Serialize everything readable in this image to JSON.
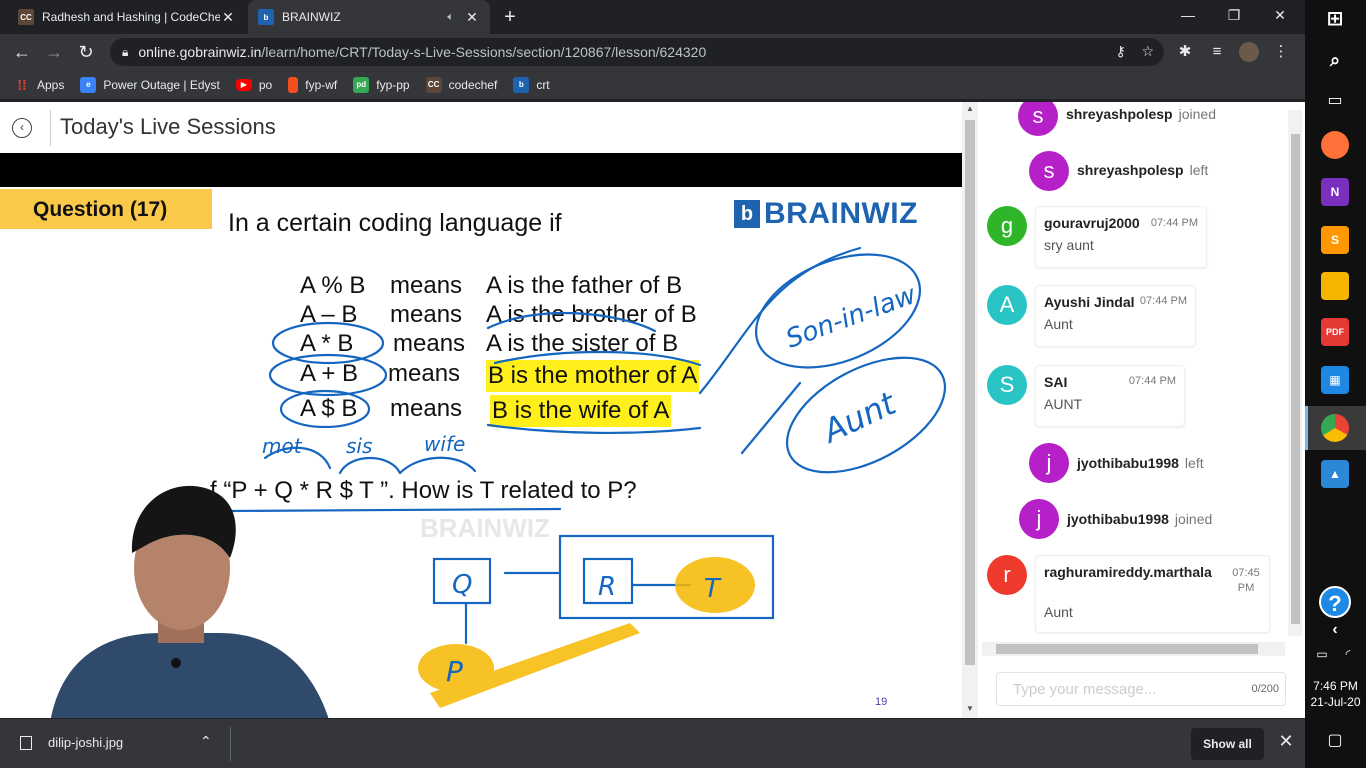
{
  "browser": {
    "tabs": [
      {
        "label": "Radhesh and Hashing | CodeChe",
        "favicon": "CC",
        "favicon_color": "#5b4638",
        "active": false
      },
      {
        "label": "BRAINWIZ",
        "favicon": "b",
        "favicon_color": "#1e63b0",
        "active": true
      }
    ],
    "url_host": "online.gobrainwiz.in",
    "url_path": "/learn/home/CRT/Today-s-Live-Sessions/section/120867/lesson/624320",
    "bookmarks": [
      {
        "label": "Apps",
        "icon": "apps-grid-icon",
        "color": "#ea4335"
      },
      {
        "label": "Power Outage | Edyst",
        "icon": "edyst-icon",
        "color": "#3b82f6"
      },
      {
        "label": "po",
        "icon": "youtube-icon",
        "color": "#ff0000"
      },
      {
        "label": "fyp-wf",
        "icon": "figma-icon",
        "color": "#f24e1e"
      },
      {
        "label": "fyp-pp",
        "icon": "pd-icon",
        "color": "#34a853"
      },
      {
        "label": "codechef",
        "icon": "codechef-icon",
        "color": "#5b4638"
      },
      {
        "label": "crt",
        "icon": "brainwiz-icon",
        "color": "#1e63b0"
      }
    ]
  },
  "page": {
    "title": "Today's Live Sessions"
  },
  "slide": {
    "question_label": "Question (17)",
    "intro": "In a certain coding language if",
    "brand": "BRAINWIZ",
    "rules": [
      {
        "left": "A % B",
        "mid": "means",
        "right": "A is the father of B",
        "highlight": false
      },
      {
        "left": "A – B",
        "mid": "means",
        "right": "A is the brother of B",
        "highlight": false
      },
      {
        "left": "A * B",
        "mid": "means",
        "right": "A is the sister of B",
        "highlight": false
      },
      {
        "left": "A + B",
        "mid": "means",
        "right": "B is the mother of A",
        "highlight": true
      },
      {
        "left": "A $ B",
        "mid": "means",
        "right": "B is the wife of A",
        "highlight": true
      }
    ],
    "puzzle": "f  “P  +   Q   *  R   $   T ”.  How is T related to P?",
    "slide_number": "19",
    "watermark": "BRAINWIZ",
    "handwriting": {
      "annot1": "mot",
      "annot2": "sis",
      "annot3": "wife",
      "son_in_law": "Son-in-law",
      "aunt": "Aunt",
      "node_q": "Q",
      "node_r": "R",
      "node_t": "T",
      "node_p": "P"
    }
  },
  "chat": {
    "messages": [
      {
        "kind": "system",
        "user": "shreyashpolesp",
        "action": "joined",
        "initial": "s",
        "color": "#b620c8"
      },
      {
        "kind": "system",
        "user": "shreyashpolesp",
        "action": "left",
        "initial": "s",
        "color": "#b620c8"
      },
      {
        "kind": "message",
        "user": "gouravruj2000",
        "time": "07:44 PM",
        "text": "sry aunt",
        "initial": "g",
        "color": "#2fb52a"
      },
      {
        "kind": "message",
        "user": "Ayushi Jindal",
        "time": "07:44 PM",
        "text": "Aunt",
        "initial": "A",
        "color": "#2bc4c4"
      },
      {
        "kind": "message",
        "user": "SAI",
        "time": "07:44 PM",
        "text": "AUNT",
        "initial": "S",
        "color": "#2bc4c4"
      },
      {
        "kind": "system",
        "user": "jyothibabu1998",
        "action": "left",
        "initial": "j",
        "color": "#b620c8"
      },
      {
        "kind": "system",
        "user": "jyothibabu1998",
        "action": "joined",
        "initial": "j",
        "color": "#b620c8"
      },
      {
        "kind": "message",
        "user": "raghuramireddy.marthala",
        "time": "07:45 PM",
        "text": "Aunt",
        "initial": "r",
        "color": "#ef3b2e"
      }
    ],
    "input_placeholder": "Type your message...",
    "char_count": "0/200"
  },
  "downloads": {
    "file": "dilip-joshi.jpg",
    "show_all": "Show all"
  },
  "taskbar": {
    "time": "7:46 PM",
    "date": "21-Jul-20"
  }
}
